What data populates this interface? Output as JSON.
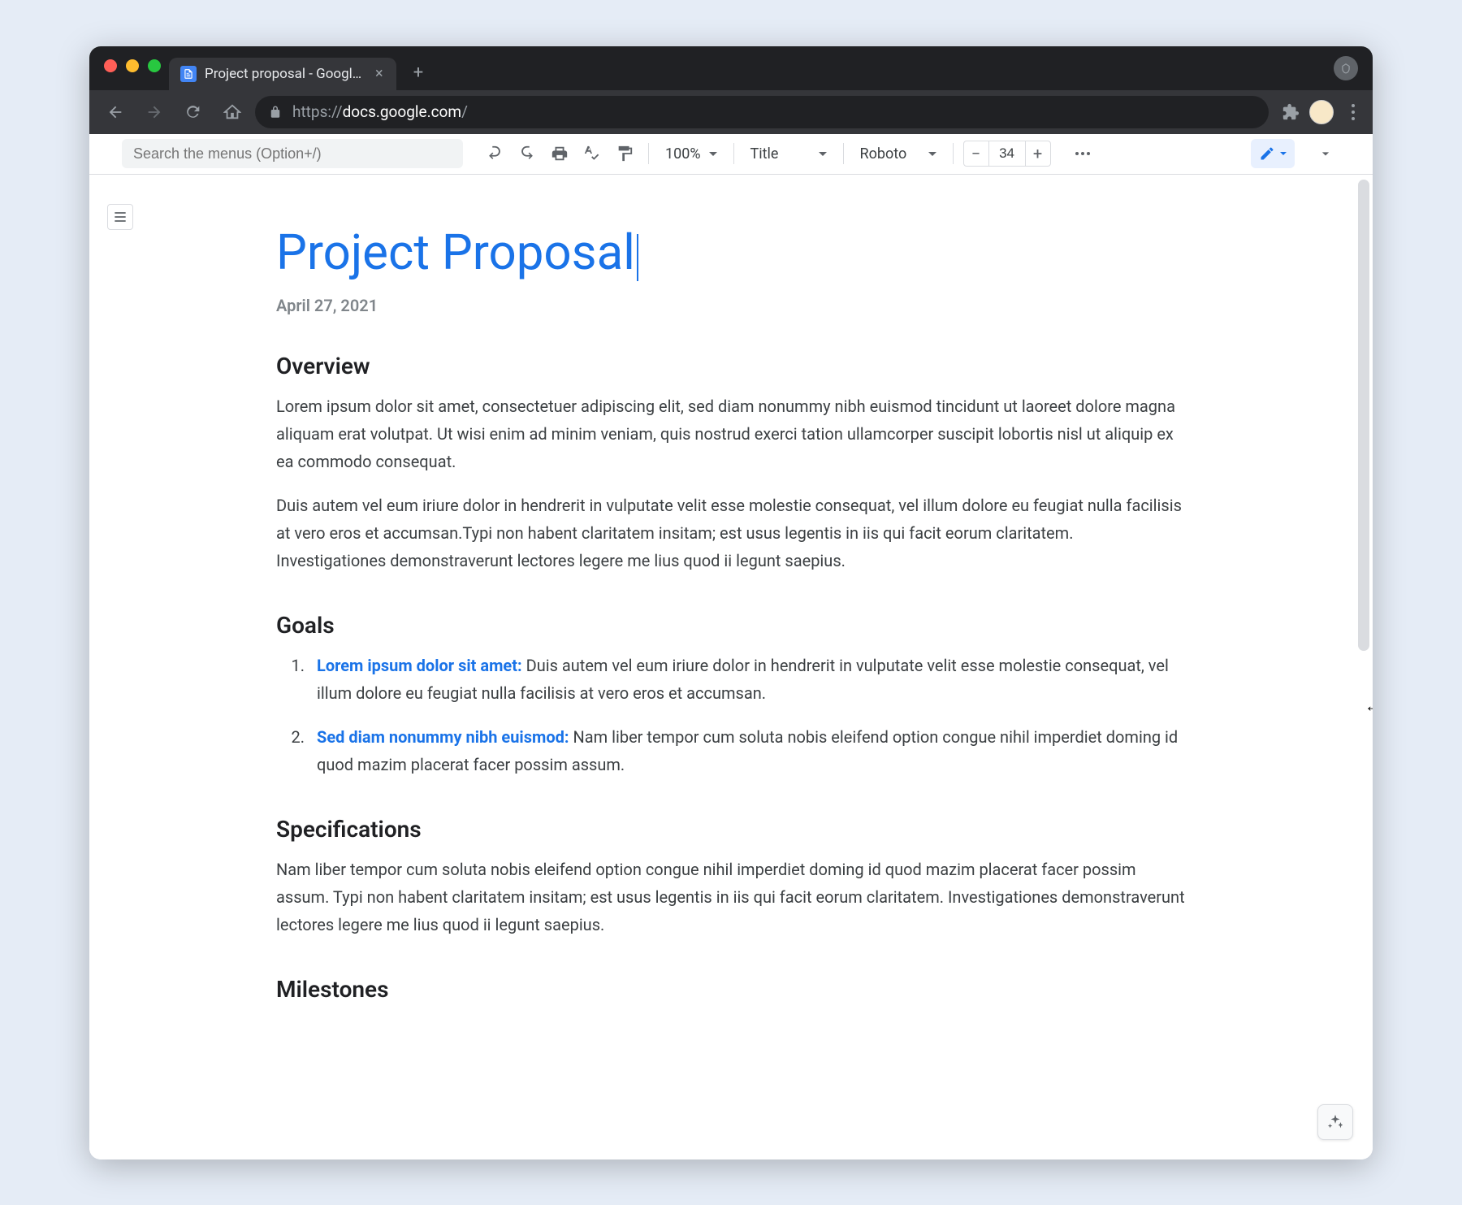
{
  "browser": {
    "tab_title": "Project proposal - Google Docs",
    "url_scheme": "https://",
    "url_host": "docs.google.com",
    "url_path": "/"
  },
  "toolbar": {
    "search_placeholder": "Search the menus (Option+/)",
    "zoom": "100%",
    "style": "Title",
    "font": "Roboto",
    "font_size": "34"
  },
  "doc": {
    "title": "Project Proposal",
    "date": "April 27, 2021",
    "sections": {
      "overview": {
        "heading": "Overview",
        "p1": "Lorem ipsum dolor sit amet, consectetuer adipiscing elit, sed diam nonummy nibh euismod tincidunt ut laoreet dolore magna aliquam erat volutpat. Ut wisi enim ad minim veniam, quis nostrud exerci tation ullamcorper suscipit lobortis nisl ut aliquip ex ea commodo consequat.",
        "p2": "Duis autem vel eum iriure dolor in hendrerit in vulputate velit esse molestie consequat, vel illum dolore eu feugiat nulla facilisis at vero eros et accumsan.Typi non habent claritatem insitam; est usus legentis in iis qui facit eorum claritatem. Investigationes demonstraverunt lectores legere me lius quod ii legunt saepius."
      },
      "goals": {
        "heading": "Goals",
        "items": [
          {
            "label": "Lorem ipsum dolor sit amet:",
            "text": " Duis autem vel eum iriure dolor in hendrerit in vulputate velit esse molestie consequat, vel illum dolore eu feugiat nulla facilisis at vero eros et accumsan."
          },
          {
            "label": "Sed diam nonummy nibh euismod:",
            "text": " Nam liber tempor cum soluta nobis eleifend option congue nihil imperdiet doming id quod mazim placerat facer possim assum."
          }
        ]
      },
      "specifications": {
        "heading": "Specifications",
        "p1": "Nam liber tempor cum soluta nobis eleifend option congue nihil imperdiet doming id quod mazim placerat facer possim assum. Typi non habent claritatem insitam; est usus legentis in iis qui facit eorum claritatem. Investigationes demonstraverunt lectores legere me lius quod ii legunt saepius."
      },
      "milestones": {
        "heading": "Milestones"
      }
    }
  }
}
